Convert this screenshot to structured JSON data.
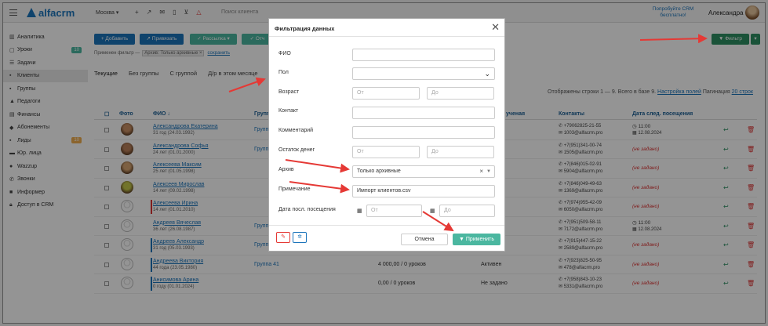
{
  "topbar": {
    "logo": "alfacrm",
    "branch": "Москва ▾",
    "client_search": "Поиск клиента",
    "promo": "Попробуйте CRM бесплатно!",
    "user_name": "Александра ▾"
  },
  "sidebar": {
    "items": [
      {
        "label": "Аналитика",
        "icon": "chart-icon"
      },
      {
        "label": "Уроки",
        "icon": "calendar-icon",
        "badge": "10"
      },
      {
        "label": "Задачи",
        "icon": "tasks-icon"
      },
      {
        "label": "Клиенты",
        "icon": "user-icon",
        "active": true
      },
      {
        "label": "Группы",
        "icon": "users-icon"
      },
      {
        "label": "Педагоги",
        "icon": "graduation-cap-icon"
      },
      {
        "label": "Финансы",
        "icon": "money-icon"
      },
      {
        "label": "Абонементы",
        "icon": "ticket-icon"
      },
      {
        "label": "Лиды",
        "icon": "lead-icon",
        "badge": "10"
      },
      {
        "label": "Юр. лица",
        "icon": "building-icon"
      },
      {
        "label": "Wazzup",
        "icon": "whatsapp-icon"
      },
      {
        "label": "Звонки",
        "icon": "phone-icon"
      },
      {
        "label": "Информер",
        "icon": "bell-icon"
      },
      {
        "label": "Доступ в CRM",
        "icon": "lock-icon"
      }
    ]
  },
  "toolbar": {
    "add": "+ Добавить",
    "apply": "↗ Привязать",
    "mailing": "✓ Рассылка ▾",
    "other": "✓ Отч",
    "filter": "▼ Фильтр"
  },
  "applied_filter": {
    "label": "Применен фильтр —",
    "chip": "Архив: Только архивные ×",
    "save": "сохранить"
  },
  "tabs": [
    "Текущие",
    "Без группы",
    "С группой",
    "Д/р в этом месяце"
  ],
  "pagination": {
    "shown": "Отображены строки 1 — 9. Всего в базе 9.",
    "settings": "Настройка полей",
    "pag_label": "Пагинация",
    "pag_value": "20 строк"
  },
  "table": {
    "headers": {
      "photo": "Фото",
      "name": "ФИО ↓",
      "group": "Групп",
      "status": "ученая",
      "contacts": "Контакты",
      "next_date": "Дата след. посещения"
    },
    "rows": [
      {
        "name": "Александрова Екатерина",
        "age": "31 год (24.03.1992)",
        "group": "Групп",
        "balance": "",
        "status": "",
        "phone": "+79062825-21-55",
        "email": "1003@alfacrm.pro",
        "date": "11:00",
        "date2": "12.08.2024",
        "photo": "real",
        "flag": ""
      },
      {
        "name": "Александрова Софья",
        "age": "24 лет (01.01.2000)",
        "group": "Групп",
        "balance": "",
        "status": "",
        "phone": "+7(951)341-00-74",
        "email": "1505@alfacrm.pro",
        "date": "(не задано)",
        "date2": "",
        "photo": "real",
        "flag": ""
      },
      {
        "name": "Алексеева Максим",
        "age": "25 лет (01.05.1998)",
        "group": "",
        "balance": "",
        "status": "",
        "phone": "+7(846)015-02-91",
        "email": "5904@alfacrm.pro",
        "date": "(не задано)",
        "date2": "",
        "photo": "real",
        "flag": ""
      },
      {
        "name": "Алексеев Мирослав",
        "age": "14 лет (09.02.1998)",
        "group": "",
        "balance": "",
        "status": "",
        "phone": "+7(846)049-49-63",
        "email": "1369@alfacrm.pro",
        "date": "(не задано)",
        "date2": "",
        "photo": "real",
        "flag": ""
      },
      {
        "name": "Алексеева Ирина",
        "age": "14 лет (01.01.2010)",
        "group": "",
        "balance": "",
        "status": "",
        "phone": "+7(974)955-42-09",
        "email": "6050@alfacrm.pro",
        "date": "(не задано)",
        "date2": "",
        "photo": "placeholder",
        "flag": "#d33"
      },
      {
        "name": "Андреев Вячеслав",
        "age": "36 лет (26.08.1987)",
        "group": "Групп",
        "balance": "",
        "status": "",
        "phone": "+7(951)509-58-11",
        "email": "7172@alfacrm.pro",
        "date": "11:00",
        "date2": "12.08.2024",
        "photo": "placeholder",
        "flag": ""
      },
      {
        "name": "Андреев Александр",
        "age": "31 год (05.03.1993)",
        "group": "Группа 20",
        "balance": "10 000,00 / 0 уроков",
        "status": "Активен",
        "phone": "+7(915)447-15-22",
        "email": "2589@alfacrm.pro",
        "date": "(не задано)",
        "date2": "",
        "photo": "placeholder",
        "flag": "#1b74bb"
      },
      {
        "name": "Андреева Виктория",
        "age": "44 года (23.05.1980)",
        "group": "Группа 41",
        "balance": "4 000,00 / 0 уроков",
        "status": "Активен",
        "phone": "+7(923)825-50-95",
        "email": "478@alfacrm.pro",
        "date": "(не задано)",
        "date2": "",
        "photo": "placeholder",
        "flag": "#1b74bb"
      },
      {
        "name": "Анисимова Арина",
        "age": "0 году (01.01.2024)",
        "group": "",
        "balance": "0,00 / 0 уроков",
        "status": "Не задано",
        "phone": "+7(958)843-10-23",
        "email": "5331@alfacrm.pro",
        "date": "(не задано)",
        "date2": "",
        "photo": "placeholder",
        "flag": "#1b74bb"
      }
    ]
  },
  "modal": {
    "title": "Фильтрация данных",
    "fields": {
      "fio": {
        "label": "ФИО",
        "value": ""
      },
      "gender": {
        "label": "Пол",
        "value": ""
      },
      "age": {
        "label": "Возраст",
        "from": "От",
        "to": "До"
      },
      "contact": {
        "label": "Контакт",
        "value": ""
      },
      "comment": {
        "label": "Комментарий",
        "value": ""
      },
      "balance": {
        "label": "Остаток денег",
        "from": "От",
        "to": "До"
      },
      "archive": {
        "label": "Архив",
        "value": "Только архивные"
      },
      "note": {
        "label": "Примечание",
        "value": "Импорт клиентов.csv"
      },
      "last_visit": {
        "label": "Дата посл. посещения",
        "from": "От",
        "to": "До"
      }
    },
    "cancel": "Отмена",
    "apply": "▼ Применить"
  },
  "colors": {
    "brand": "#1b74bb",
    "accent_green": "#4bb7a0",
    "arrow_red": "#e53935"
  }
}
